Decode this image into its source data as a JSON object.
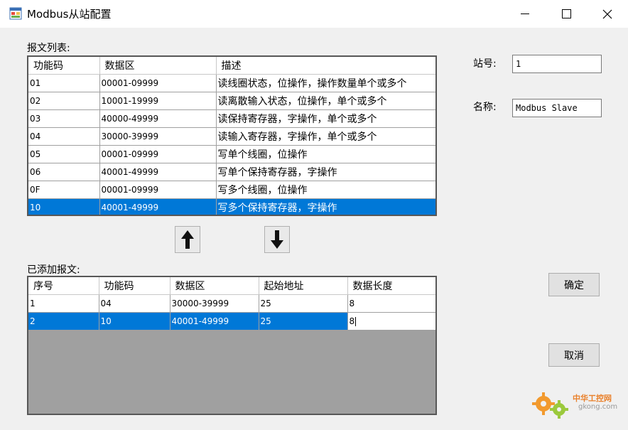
{
  "window": {
    "title": "Modbus从站配置",
    "icon": "app-form-icon",
    "controls": [
      "minimize-icon",
      "maximize-icon",
      "close-icon"
    ]
  },
  "message_list": {
    "label": "报文列表:",
    "headers": [
      "功能码",
      "数据区",
      "描述"
    ],
    "rows": [
      {
        "code": "01",
        "range": "00001-09999",
        "desc": "读线圈状态，位操作，操作数量单个或多个"
      },
      {
        "code": "02",
        "range": "10001-19999",
        "desc": "读离散输入状态，位操作，单个或多个"
      },
      {
        "code": "03",
        "range": "40000-49999",
        "desc": "读保持寄存器，字操作，单个或多个"
      },
      {
        "code": "04",
        "range": "30000-39999",
        "desc": "读输入寄存器，字操作，单个或多个"
      },
      {
        "code": "05",
        "range": "00001-09999",
        "desc": "写单个线圈，位操作"
      },
      {
        "code": "06",
        "range": "40001-49999",
        "desc": "写单个保持寄存器，字操作"
      },
      {
        "code": "0F",
        "range": "00001-09999",
        "desc": "写多个线圈，位操作"
      },
      {
        "code": "10",
        "range": "40001-49999",
        "desc": "写多个保持寄存器，字操作"
      }
    ],
    "selected_index": 7
  },
  "move_buttons": {
    "up_icon": "arrow-up-icon",
    "down_icon": "arrow-down-icon"
  },
  "added_list": {
    "label": "已添加报文:",
    "headers": [
      "序号",
      "功能码",
      "数据区",
      "起始地址",
      "数据长度"
    ],
    "rows": [
      {
        "index": "1",
        "code": "04",
        "range": "30000-39999",
        "start": "25",
        "length": "8"
      },
      {
        "index": "2",
        "code": "10",
        "range": "40001-49999",
        "start": "25",
        "length": "8"
      }
    ],
    "selected_index": 1
  },
  "station": {
    "label": "站号:",
    "value": "1"
  },
  "name": {
    "label": "名称:",
    "value": "Modbus Slave"
  },
  "buttons": {
    "ok": "确定",
    "cancel": "取消"
  },
  "watermark": {
    "line1": "中华工控网",
    "line2": "gkong.com"
  },
  "colors": {
    "selection": "#0078d7",
    "grid_background": "#a0a0a0",
    "window_background": "#f0f0f0"
  }
}
